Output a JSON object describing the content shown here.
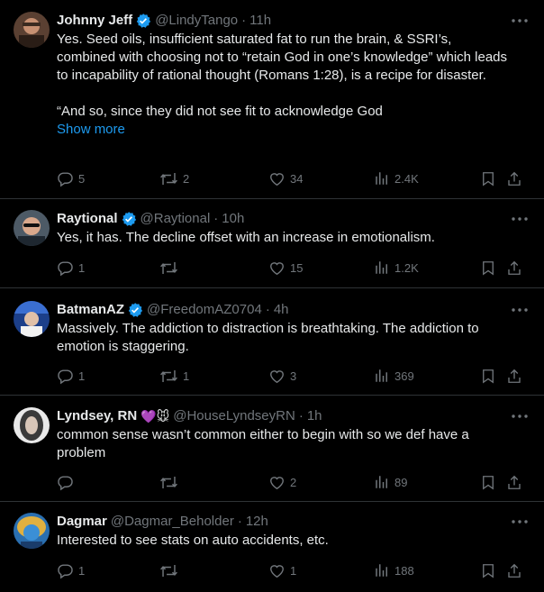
{
  "tweets": [
    {
      "name": "Johnny Jeff",
      "verified": true,
      "emoji": "",
      "handle": "@LindyTango",
      "time": "11h",
      "text": "Yes. Seed oils, insufficient saturated fat to run the brain, & SSRI’s, combined with choosing not to “retain God in one’s knowledge” which leads to incapability of rational thought (Romans 1:28), is a recipe for disaster.\n\n“And so, since they did not see fit to acknowledge God",
      "show_more": "Show more",
      "replies": "5",
      "retweets": "2",
      "likes": "34",
      "views": "2.4K"
    },
    {
      "name": "Raytional",
      "verified": true,
      "emoji": "",
      "handle": "@Raytional",
      "time": "10h",
      "text": "Yes, it has. The decline offset with an increase in emotionalism.",
      "show_more": "",
      "replies": "1",
      "retweets": "",
      "likes": "15",
      "views": "1.2K"
    },
    {
      "name": "BatmanAZ",
      "verified": true,
      "emoji": "",
      "handle": "@FreedomAZ0704",
      "time": "4h",
      "text": "Massively.  The addiction to distraction is breathtaking.  The addiction to emotion is staggering.",
      "show_more": "",
      "replies": "1",
      "retweets": "1",
      "likes": "3",
      "views": "369"
    },
    {
      "name": "Lyndsey, RN",
      "verified": false,
      "emoji": "💜🐭",
      "handle": "@HouseLyndseyRN",
      "time": "1h",
      "text": "common sense wasn’t common either to begin with so we def have a problem",
      "show_more": "",
      "replies": "",
      "retweets": "",
      "likes": "2",
      "views": "89"
    },
    {
      "name": "Dagmar",
      "verified": false,
      "emoji": "",
      "handle": "@Dagmar_Beholder",
      "time": "12h",
      "text": "Interested to see stats on auto accidents, etc.",
      "show_more": "",
      "replies": "1",
      "retweets": "",
      "likes": "1",
      "views": "188"
    }
  ],
  "colors": {
    "background": "#000000",
    "text": "#e7e9ea",
    "muted": "#71767b",
    "accent": "#1d9bf0",
    "divider": "#2f3336"
  },
  "icons": [
    "more-icon",
    "reply-icon",
    "retweet-icon",
    "like-icon",
    "views-icon",
    "bookmark-icon",
    "share-icon",
    "verified-badge-icon"
  ],
  "dot_separator": "·"
}
